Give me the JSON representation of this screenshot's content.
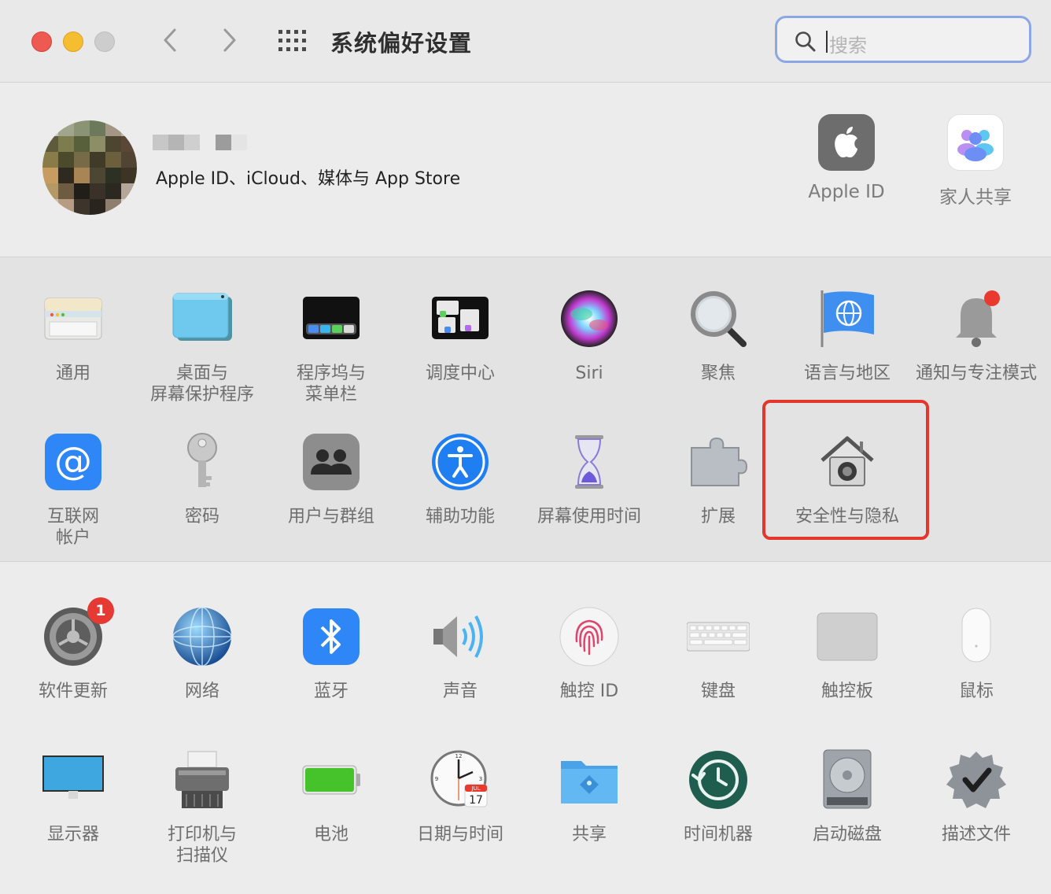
{
  "window": {
    "title": "系统偏好设置",
    "search_placeholder": "搜索",
    "back_icon": "chevron-left-icon",
    "forward_icon": "chevron-right-icon",
    "grid_icon": "grid-icon"
  },
  "account": {
    "subtitle": "Apple ID、iCloud、媒体与 App Store",
    "apple_id_label": "Apple ID",
    "family_label": "家人共享"
  },
  "row1": [
    {
      "id": "general",
      "lines": [
        "通用"
      ]
    },
    {
      "id": "desktop",
      "lines": [
        "桌面与",
        "屏幕保护程序"
      ]
    },
    {
      "id": "dock",
      "lines": [
        "程序坞与",
        "菜单栏"
      ]
    },
    {
      "id": "mission-control",
      "lines": [
        "调度中心"
      ]
    },
    {
      "id": "siri",
      "lines": [
        "Siri"
      ]
    },
    {
      "id": "spotlight",
      "lines": [
        "聚焦"
      ]
    },
    {
      "id": "language",
      "lines": [
        "语言与地区"
      ]
    },
    {
      "id": "notifications",
      "lines": [
        "通知与专注模式"
      ]
    }
  ],
  "row2": [
    {
      "id": "internet-accounts",
      "lines": [
        "互联网",
        "帐户"
      ]
    },
    {
      "id": "passwords",
      "lines": [
        "密码"
      ]
    },
    {
      "id": "users",
      "lines": [
        "用户与群组"
      ]
    },
    {
      "id": "accessibility",
      "lines": [
        "辅助功能"
      ]
    },
    {
      "id": "screen-time",
      "lines": [
        "屏幕使用时间"
      ]
    },
    {
      "id": "extensions",
      "lines": [
        "扩展"
      ]
    },
    {
      "id": "security",
      "lines": [
        "安全性与隐私"
      ]
    }
  ],
  "row3": [
    {
      "id": "software-update",
      "lines": [
        "软件更新"
      ],
      "badge": "1"
    },
    {
      "id": "network",
      "lines": [
        "网络"
      ]
    },
    {
      "id": "bluetooth",
      "lines": [
        "蓝牙"
      ]
    },
    {
      "id": "sound",
      "lines": [
        "声音"
      ]
    },
    {
      "id": "touch-id",
      "lines": [
        "触控 ID"
      ]
    },
    {
      "id": "keyboard",
      "lines": [
        "键盘"
      ]
    },
    {
      "id": "trackpad",
      "lines": [
        "触控板"
      ]
    },
    {
      "id": "mouse",
      "lines": [
        "鼠标"
      ]
    }
  ],
  "row4": [
    {
      "id": "displays",
      "lines": [
        "显示器"
      ]
    },
    {
      "id": "printers",
      "lines": [
        "打印机与",
        "扫描仪"
      ]
    },
    {
      "id": "battery",
      "lines": [
        "电池"
      ]
    },
    {
      "id": "date-time",
      "lines": [
        "日期与时间"
      ]
    },
    {
      "id": "sharing",
      "lines": [
        "共享"
      ]
    },
    {
      "id": "time-machine",
      "lines": [
        "时间机器"
      ]
    },
    {
      "id": "startup-disk",
      "lines": [
        "启动磁盘"
      ]
    },
    {
      "id": "profiles",
      "lines": [
        "描述文件"
      ]
    }
  ],
  "calendar_icon": {
    "month": "JUL",
    "day": "17"
  },
  "colors": {
    "highlight": "#e2372d",
    "badge": "#e53a33"
  }
}
